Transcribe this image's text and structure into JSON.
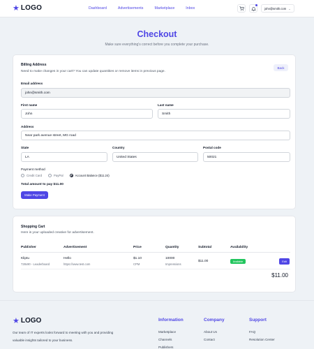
{
  "header": {
    "logo_text": "LOGO",
    "nav": [
      "Dashboard",
      "Advertisements",
      "Marketplace",
      "Inbox"
    ],
    "user_email": "john@smith.com"
  },
  "page": {
    "title": "Checkout",
    "subtitle": "Make sure everything's correct before you complete your purchase."
  },
  "billing": {
    "title": "Billing Address",
    "description": "Need to make changes in your cart? You can update quantities or remove items in previous page.",
    "back_label": "Back",
    "email_label": "Email address",
    "email_value": "john@smith.com",
    "first_name_label": "First name",
    "first_name_value": "John",
    "last_name_label": "Last name",
    "last_name_value": "Smith",
    "address_label": "Address",
    "address_value": "Near park avenue street, MG road",
    "state_label": "State",
    "state_value": "LA",
    "country_label": "Country",
    "country_value": "United States",
    "postal_label": "Postal code",
    "postal_value": "50021",
    "payment_label": "Payment method",
    "payment_options": [
      "Credit Card",
      "PayPal",
      "Account Balance ($11.24)"
    ],
    "payment_selected": "Account Balance ($11.24)",
    "total_text": "Total amount to pay $11.00",
    "pay_button": "Make Payment"
  },
  "cart": {
    "title": "Shopping Cart",
    "description": "Here is your uploaded creative for advertisement.",
    "columns": [
      "Publisher",
      "Advertisement",
      "Price",
      "Quantity",
      "Subtotal",
      "Availability"
    ],
    "rows": [
      {
        "publisher": "Kliptu",
        "publisher_sub": "728x90 - Leaderboard",
        "ad_title": "Hello",
        "ad_url": "https://www.test.com",
        "price": "$1.10",
        "price_unit": "CPM",
        "quantity": "10000",
        "quantity_unit": "Impressions",
        "subtotal": "$11.00",
        "availability": "Available",
        "edit_label": "Edit"
      }
    ],
    "total": "$11.00"
  },
  "footer": {
    "logo_text": "LOGO",
    "description": "Our team of IT experts looks forward to meeting with you and providing valuable insights tailored to your business.",
    "columns": [
      {
        "title": "Information",
        "links": [
          "Marketplace",
          "Channels",
          "Publishers"
        ]
      },
      {
        "title": "Company",
        "links": [
          "About Us",
          "Contact"
        ]
      },
      {
        "title": "Support",
        "links": [
          "FAQ",
          "Resolution Center"
        ]
      }
    ]
  },
  "colors": {
    "accent": "#4f46e5",
    "available": "#22c55e",
    "background": "#eef2f6"
  }
}
